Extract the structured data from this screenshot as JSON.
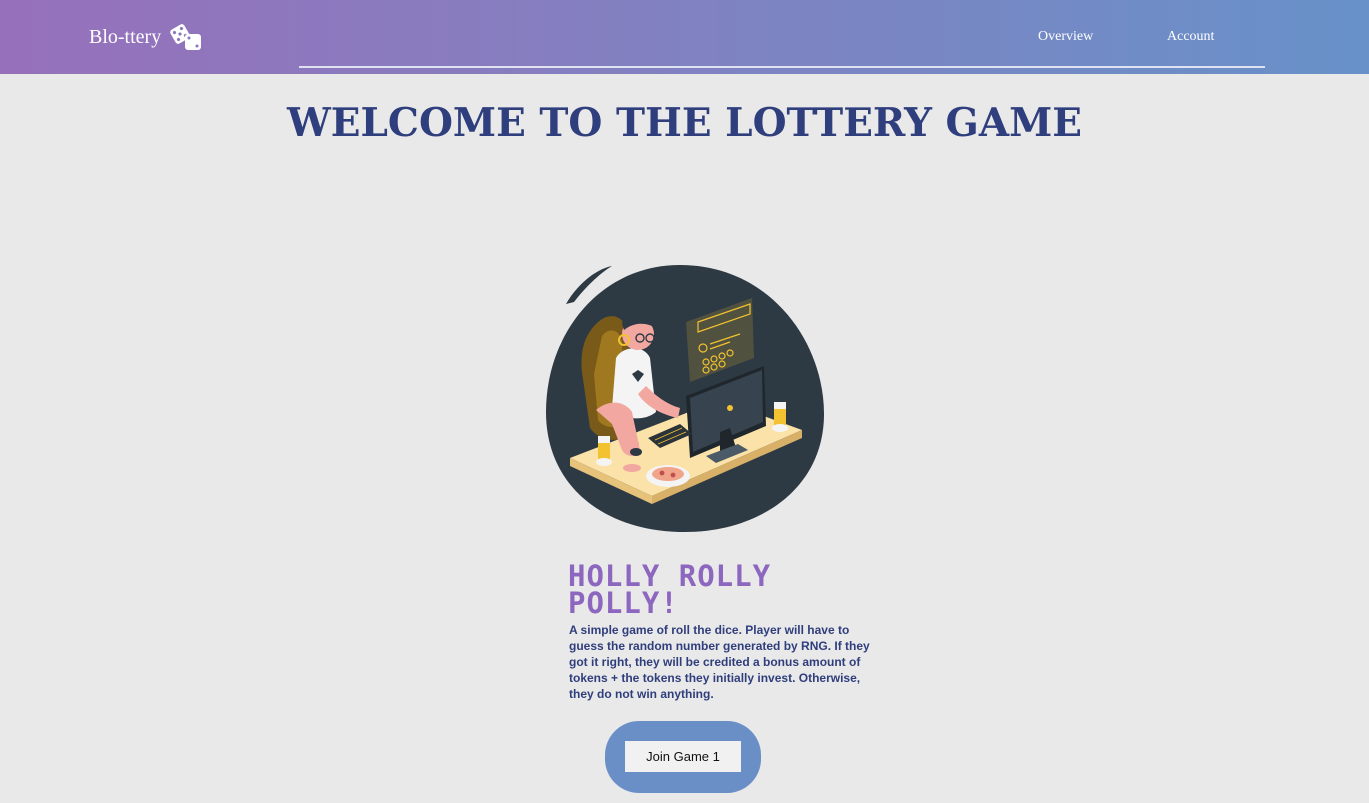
{
  "header": {
    "brand": "Blo-ttery",
    "brand_icon": "dice-icon",
    "nav": [
      {
        "label": "Overview"
      },
      {
        "label": "Account"
      }
    ]
  },
  "main": {
    "title": "WELCOME TO THE LOTTERY GAME",
    "illustration": "gamer-at-desk-illustration",
    "game": {
      "name": "HOLLY ROLLY POLLY!",
      "description": "A simple game of roll the dice. Player will have to guess the random number generated by RNG. If they got it right, they will be credited a bonus amount of tokens + the tokens they initially invest. Otherwise, they do not win anything.",
      "join_label": "Join Game 1"
    }
  },
  "colors": {
    "header_gradient_start": "#9770bb",
    "header_gradient_end": "#6891c9",
    "title": "#2f3e7c",
    "game_title": "#8c66bf",
    "join_backdrop": "#6a8fc6",
    "background": "#e9e9e9"
  }
}
